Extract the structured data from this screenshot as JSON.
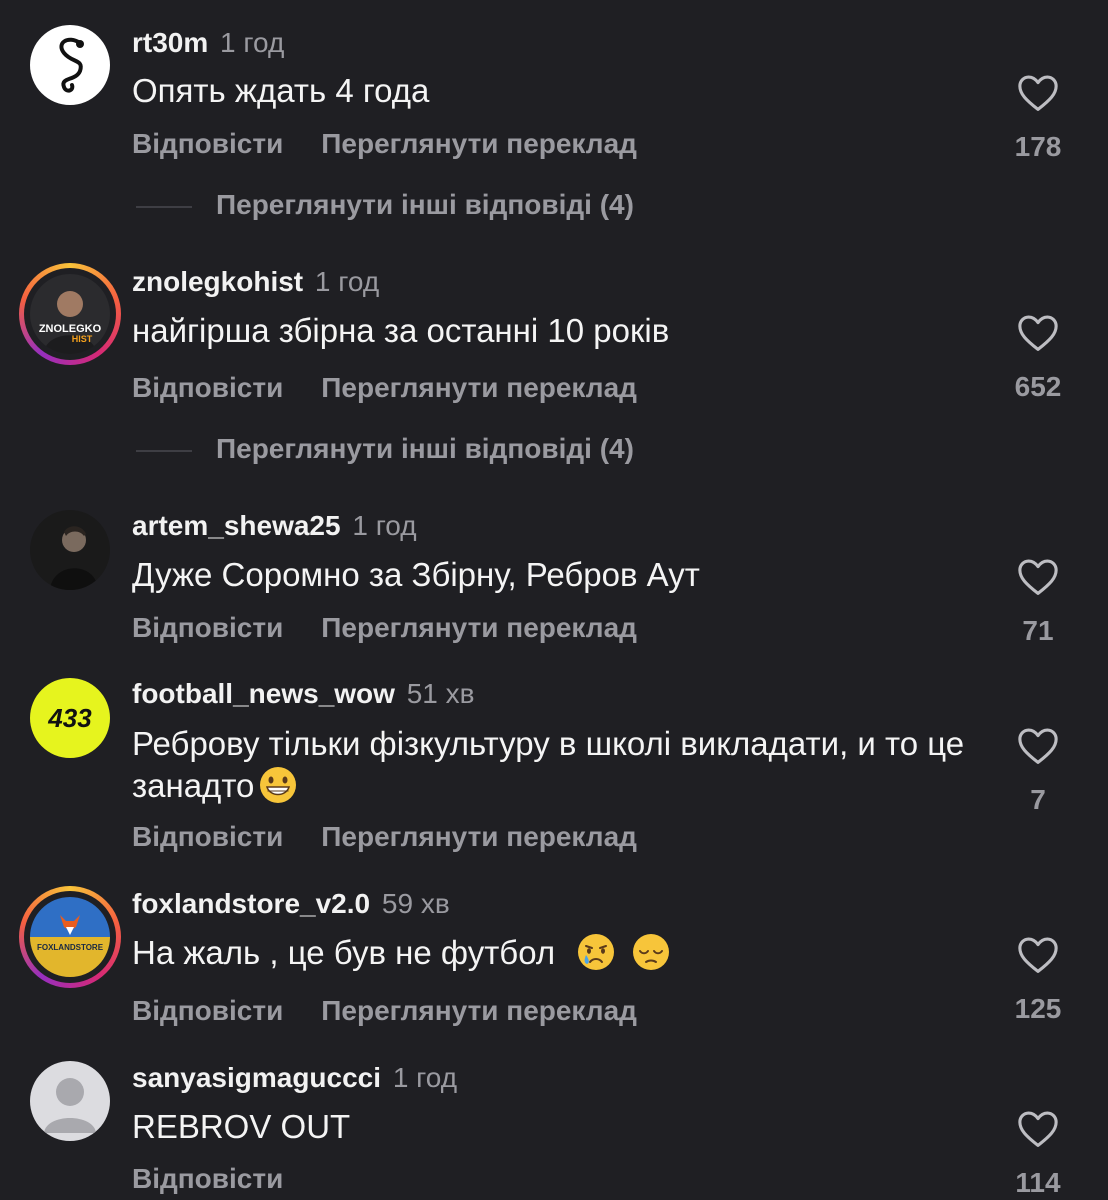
{
  "actions": {
    "reply": "Відповісти",
    "translate": "Переглянути переклад"
  },
  "comments": [
    {
      "username": "rt30m",
      "time": "1 год",
      "text": "Опять ждать 4 года",
      "likes": "178",
      "more_replies": "Переглянути інші відповіді (4)",
      "avatar_icon": "snake-logo-icon"
    },
    {
      "username": "znolegkohist",
      "time": "1 год",
      "text": "найгірша збірна за останні 10 років",
      "likes": "652",
      "more_replies": "Переглянути інші відповіді (4)",
      "avatar_label": "ZNOLEGKO HIST"
    },
    {
      "username": "artem_shewa25",
      "time": "1 год",
      "text": "Дуже Соромно за Збірну, Ребров Аут",
      "likes": "71"
    },
    {
      "username": "football_news_wow",
      "time": "51 хв",
      "text": "Реброву тільки фізкультуру в школі викладати, и то це занадто",
      "likes": "7",
      "avatar_label": "433",
      "emoji": "grinning-face"
    },
    {
      "username": "foxlandstore_v2.0",
      "time": "59 хв",
      "text": "На жаль , це був не футбол",
      "likes": "125",
      "avatar_label": "FOXLANDSTORE",
      "emoji": [
        "crying-face",
        "pensive-face"
      ]
    },
    {
      "username": "sanyasigmaguccci",
      "time": "1 год",
      "text": "REBROV OUT",
      "likes": "114",
      "avatar_icon": "default-user-icon"
    }
  ],
  "colors": {
    "background": "#1f1f23",
    "secondary_text": "#9a9aa0",
    "accent_433": "#e6f41e"
  }
}
